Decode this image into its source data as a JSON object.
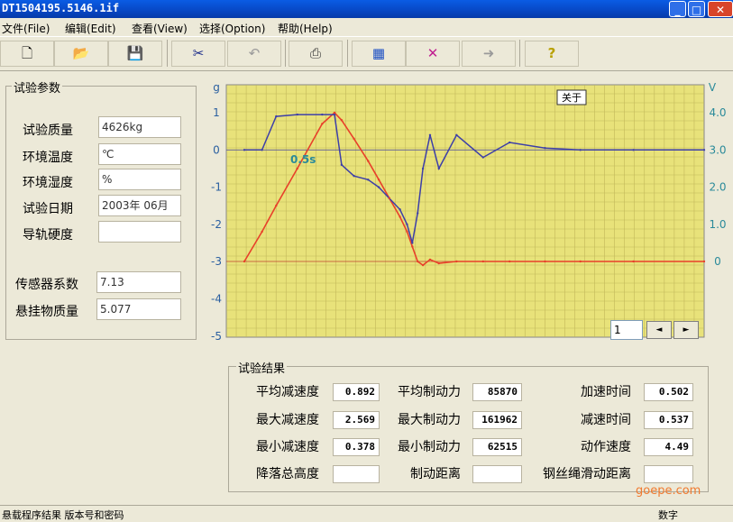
{
  "window": {
    "title": "DT1504195.5146.1if",
    "min_glyph": "_",
    "max_glyph": "□",
    "close_glyph": "✕"
  },
  "menu": [
    {
      "label": "文件(File)"
    },
    {
      "label": "编辑(Edit)"
    },
    {
      "label": "查看(View)"
    },
    {
      "label": "选择(Option)"
    },
    {
      "label": "帮助(Help)"
    }
  ],
  "toolbar": {
    "buttons": [
      {
        "icon": "new-file-icon",
        "glyph": "🗋",
        "color": "#000000"
      },
      {
        "icon": "open-folder-icon",
        "glyph": "📂",
        "color": "#8a6a00"
      },
      {
        "icon": "save-icon",
        "glyph": "💾",
        "color": "#000000"
      },
      {
        "icon": "cut-icon",
        "glyph": "✂",
        "color": "#1b2c8a"
      },
      {
        "icon": "undo-icon",
        "glyph": "↶",
        "color": "#9a9a9a"
      },
      {
        "icon": "print-icon",
        "glyph": "⎙",
        "color": "#333333"
      },
      {
        "icon": "chart-icon",
        "glyph": "▦",
        "color": "#1b4fc4"
      },
      {
        "icon": "mark-icon",
        "glyph": "✕",
        "color": "#c02090"
      },
      {
        "icon": "arrow-right-icon",
        "glyph": "➜",
        "color": "#9a9a9a"
      },
      {
        "icon": "help-icon",
        "glyph": "?",
        "color": "#b8a000"
      }
    ]
  },
  "params": {
    "title": "试验参数",
    "fields": [
      {
        "label": "试验质量",
        "value": "4626kg"
      },
      {
        "label": "环境温度",
        "value": "℃"
      },
      {
        "label": "环境湿度",
        "value": "%"
      },
      {
        "label": "试验日期",
        "value": "2003年 06月"
      },
      {
        "label": "导轨硬度",
        "value": ""
      },
      {
        "label": "传感器系数",
        "value": "7.13"
      },
      {
        "label": "悬挂物质量",
        "value": "5.077"
      }
    ]
  },
  "chart": {
    "about_label": "关于",
    "annotation": "0.5s",
    "left_axis_label": "g",
    "right_axis_label": "V",
    "colors": {
      "plot_bg": "#e8e27a",
      "grid": "#c2b85a",
      "accel": "#3d3fa8",
      "velocity": "#e8402a",
      "left_ticks": "#2a5fa0",
      "right_ticks": "#2a8a9a"
    }
  },
  "chart_data": {
    "type": "line",
    "x": [
      0,
      0.1,
      0.18,
      0.3,
      0.44,
      0.51,
      0.55,
      0.62,
      0.7,
      0.76,
      0.82,
      0.88,
      0.92,
      0.95,
      0.98,
      1.01,
      1.05,
      1.1,
      1.2,
      1.35,
      1.5,
      1.7,
      1.9,
      2.2,
      2.6
    ],
    "ylim": [
      -5,
      1.5
    ],
    "y_right_lim": [
      0,
      4.25
    ],
    "y_ticks": [
      "1",
      "0",
      "-1",
      "-2",
      "-3",
      "-4",
      "-5"
    ],
    "y_right_ticks": [
      "4.0",
      "3.0",
      "2.0",
      "1.0",
      "0"
    ],
    "series": [
      {
        "axis": "left",
        "values": [
          0,
          0,
          0.9,
          0.95,
          0.95,
          0.95,
          -0.4,
          -0.7,
          -0.8,
          -1.0,
          -1.3,
          -1.6,
          -2.0,
          -2.5,
          -1.7,
          -0.5,
          0.4,
          -0.5,
          0.4,
          -0.2,
          0.2,
          0.05,
          0,
          0,
          0
        ]
      },
      {
        "axis": "right",
        "values": [
          0,
          0.8,
          1.5,
          2.5,
          3.7,
          4.0,
          3.8,
          3.3,
          2.7,
          2.2,
          1.7,
          1.2,
          0.8,
          0.4,
          0,
          -0.1,
          0.05,
          -0.05,
          0,
          0,
          0,
          0,
          0,
          0,
          0
        ]
      }
    ]
  },
  "pager": {
    "value": "1",
    "prev_glyph": "◄",
    "next_glyph": "►"
  },
  "results": {
    "title": "试验结果",
    "rows": [
      [
        {
          "label": "平均减速度",
          "value": "0.892"
        },
        {
          "label": "平均制动力",
          "value": "85870"
        },
        {
          "label": "加速时间",
          "value": "0.502"
        }
      ],
      [
        {
          "label": "最大减速度",
          "value": "2.569"
        },
        {
          "label": "最大制动力",
          "value": "161962"
        },
        {
          "label": "减速时间",
          "value": "0.537"
        }
      ],
      [
        {
          "label": "最小减速度",
          "value": "0.378"
        },
        {
          "label": "最小制动力",
          "value": "62515"
        },
        {
          "label": "动作速度",
          "value": "4.49"
        }
      ],
      [
        {
          "label": "降落总高度",
          "value": ""
        },
        {
          "label": "制动距离",
          "value": ""
        },
        {
          "label": "钢丝绳滑动距离",
          "value": ""
        }
      ]
    ]
  },
  "status": {
    "text": "悬载程序结果   版本号和密码",
    "right": "数字"
  },
  "watermark": "goepe.com"
}
